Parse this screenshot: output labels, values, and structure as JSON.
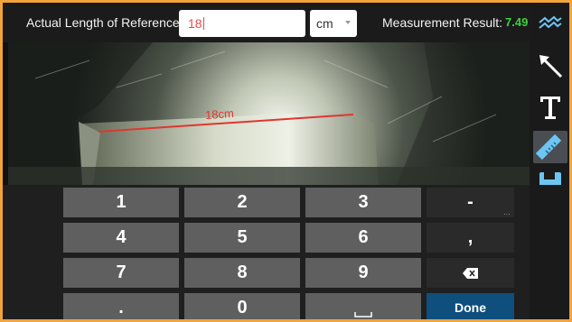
{
  "header": {
    "reference_label": "Actual Length of Reference",
    "reference_value": "18",
    "unit": "cm",
    "result_label": "Measurement Result:",
    "result_value": "7.49"
  },
  "camera": {
    "measurement_label": "18cm"
  },
  "sidebar": {
    "tools": [
      {
        "icon": "wave-icon"
      },
      {
        "icon": "arrow-icon"
      },
      {
        "icon": "text-icon"
      },
      {
        "icon": "ruler-icon",
        "selected": true
      },
      {
        "icon": "save-icon"
      }
    ]
  },
  "keypad": {
    "rows": [
      [
        "1",
        "2",
        "3",
        "-"
      ],
      [
        "4",
        "5",
        "6",
        ","
      ],
      [
        "7",
        "8",
        "9",
        ""
      ],
      [
        ".",
        "0",
        "",
        "Done"
      ]
    ]
  },
  "colors": {
    "frame": "#f2a33a",
    "result_value": "#3fd13f",
    "measure_line": "#e0362f",
    "done_key": "#0e4f7d"
  }
}
